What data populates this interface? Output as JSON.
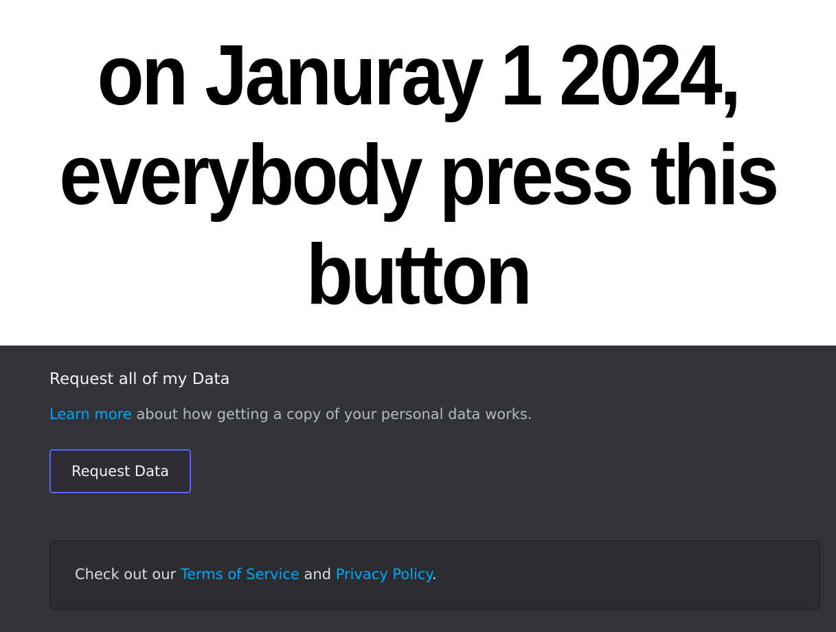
{
  "caption": {
    "lines": [
      "on Januray 1 2024,",
      "everybody press this",
      "button"
    ]
  },
  "data_request": {
    "title": "Request all of my Data",
    "learn_more_link": "Learn more",
    "description_rest": " about how getting a copy of your personal data works.",
    "button_label": "Request Data"
  },
  "legal_notice": {
    "prefix": "Check out our ",
    "terms_link": "Terms of Service",
    "middle": " and ",
    "privacy_link": "Privacy Policy",
    "suffix": "."
  },
  "colors": {
    "panel_background": "#313338",
    "link": "#00a8fc",
    "button_border": "#5865f2"
  }
}
